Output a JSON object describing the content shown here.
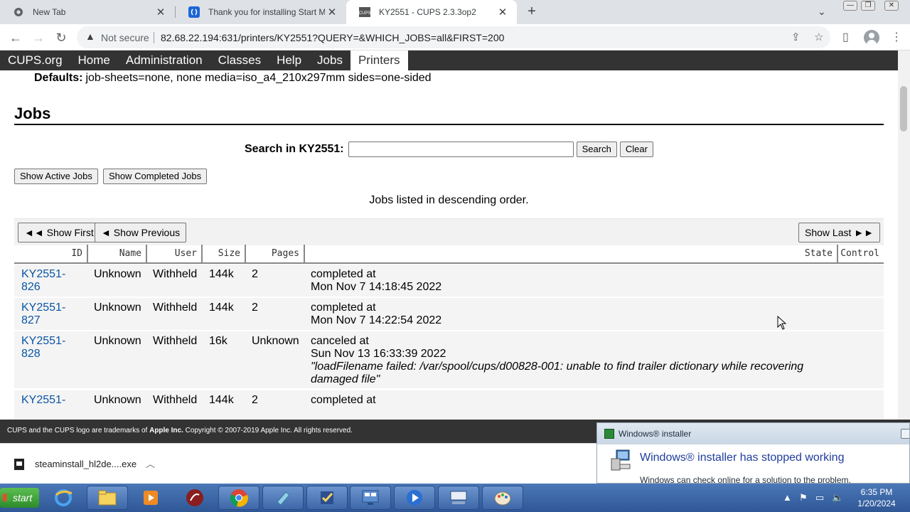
{
  "browser": {
    "tabs": [
      {
        "title": "New Tab",
        "favicon": "chrome-icon"
      },
      {
        "title": "Thank you for installing Start Me",
        "favicon": "startme-icon"
      },
      {
        "title": "KY2551 - CUPS 2.3.3op2",
        "favicon": "cups-icon",
        "active": true
      }
    ],
    "new_tab_label": "+",
    "security_label": "Not secure",
    "url": "82.68.22.194:631/printers/KY2551?QUERY=&WHICH_JOBS=all&FIRST=200"
  },
  "cups": {
    "nav": [
      "CUPS.org",
      "Home",
      "Administration",
      "Classes",
      "Help",
      "Jobs",
      "Printers"
    ],
    "active_nav": "Printers",
    "defaults_label": "Defaults:",
    "defaults_value": "job-sheets=none, none media=iso_a4_210x297mm sides=one-sided",
    "section_title": "Jobs",
    "search_label": "Search in KY2551:",
    "search_value": "",
    "search_button": "Search",
    "clear_button": "Clear",
    "show_active": "Show Active Jobs",
    "show_completed": "Show Completed Jobs",
    "order_note": "Jobs listed in descending order.",
    "show_first": "◄◄ Show First",
    "show_previous": "◄ Show Previous",
    "show_last": "Show Last ►►",
    "columns": [
      "ID",
      "Name",
      "User",
      "Size",
      "Pages",
      "State",
      "Control"
    ],
    "jobs": [
      {
        "id_1": "KY2551-",
        "id_2": "826",
        "name": "Unknown",
        "user": "Withheld",
        "size": "144k",
        "pages": "2",
        "state_1": "completed at",
        "state_2": "Mon Nov 7 14:18:45 2022",
        "message": ""
      },
      {
        "id_1": "KY2551-",
        "id_2": "827",
        "name": "Unknown",
        "user": "Withheld",
        "size": "144k",
        "pages": "2",
        "state_1": "completed at",
        "state_2": "Mon Nov 7 14:22:54 2022",
        "message": ""
      },
      {
        "id_1": "KY2551-",
        "id_2": "828",
        "name": "Unknown",
        "user": "Withheld",
        "size": "16k",
        "pages": "Unknown",
        "state_1": "canceled at",
        "state_2": "Sun Nov 13 16:33:39 2022",
        "message": "\"loadFilename failed: /var/spool/cups/d00828-001: unable to find trailer dictionary while recovering damaged file\""
      },
      {
        "id_1": "KY2551-",
        "id_2": "",
        "name": "Unknown",
        "user": "Withheld",
        "size": "144k",
        "pages": "2",
        "state_1": "completed at",
        "state_2": "",
        "message": ""
      }
    ],
    "footer_prefix": "CUPS and the CUPS logo are trademarks of ",
    "footer_brand": "Apple Inc.",
    "footer_suffix": " Copyright © 2007-2019 Apple Inc. All rights reserved."
  },
  "download": {
    "filename": "steaminstall_hl2de....exe"
  },
  "error_popup": {
    "title": "Windows® installer",
    "heading": "Windows® installer has stopped working",
    "subtext": "Windows can check online for a solution to the problem."
  },
  "taskbar": {
    "start_label": "start",
    "apps": [
      "ie-icon",
      "explorer-icon",
      "media-icon",
      "app-icon",
      "chrome-icon",
      "notes-icon",
      "tasks-icon",
      "control-panel-icon",
      "media-player-icon",
      "keyboard-icon",
      "paint-icon"
    ],
    "time": "6:35 PM",
    "date": "1/20/2024"
  }
}
